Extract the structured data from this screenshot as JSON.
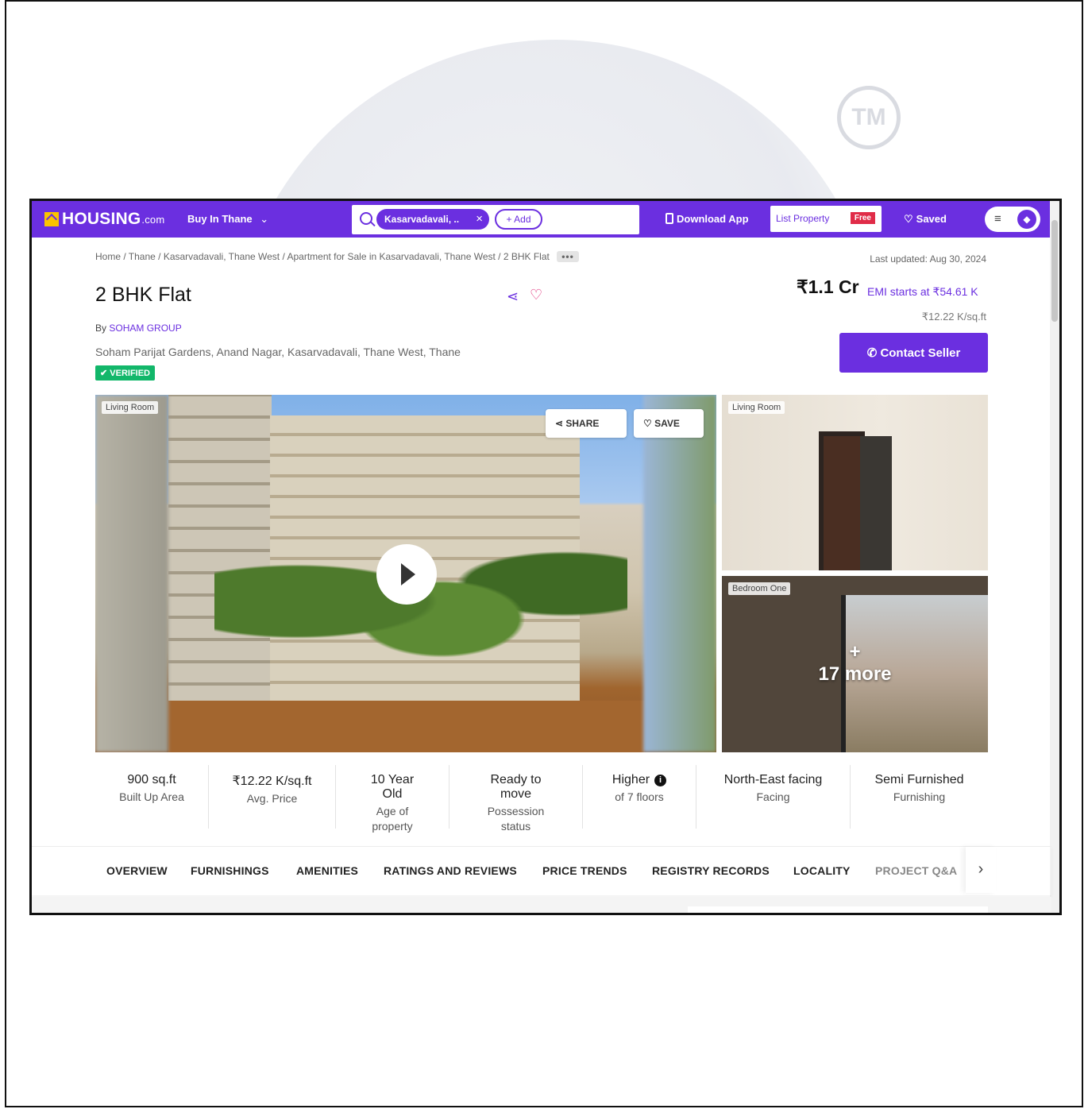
{
  "navbar": {
    "logo_text": "HOUSING",
    "logo_suffix": ".com",
    "city_menu": "Buy In Thane",
    "search_chip": "Kasarvadavali, ..",
    "add_chip": "+ Add",
    "download_app": "Download App",
    "list_property": "List Property",
    "free_badge": "Free",
    "saved": "Saved",
    "menu_icon": "hamburger-icon",
    "brand_color": "#6b2fe0"
  },
  "breadcrumb": {
    "trail": "Home / Thane / Kasarvadavali, Thane West / Apartment for Sale in Kasarvadavali, Thane West / 2 BHK Flat",
    "more": "•••"
  },
  "last_updated": "Last updated: Aug 30, 2024",
  "listing": {
    "title": "2 BHK Flat",
    "by_prefix": "By",
    "developer": "SOHAM GROUP",
    "address": "Soham Parijat Gardens, Anand Nagar, Kasarvadavali, Thane West, Thane",
    "verified": "✔ VERIFIED",
    "price": "₹1.1 Cr",
    "emi": "EMI starts at ₹54.61 K",
    "price_per_sqft": "₹12.22 K/sq.ft",
    "contact_button": "Contact Seller"
  },
  "gallery": {
    "main_tag": "Living Room",
    "share_label": "SHARE",
    "save_label": "SAVE",
    "side1_tag": "Living Room",
    "side2_tag": "Bedroom One",
    "more_plus": "+",
    "more_label": "17 more"
  },
  "facts": [
    {
      "value": "900 sq.ft",
      "label": "Built Up Area"
    },
    {
      "value": "₹12.22 K/sq.ft",
      "label": "Avg. Price"
    },
    {
      "value": "10 Year Old",
      "label": "Age of property"
    },
    {
      "value": "Ready to move",
      "label": "Possession status"
    },
    {
      "value": "Higher",
      "label": "of 7 floors"
    },
    {
      "value": "North-East facing",
      "label": "Facing"
    },
    {
      "value": "Semi Furnished",
      "label": "Furnishing"
    }
  ],
  "tabs": [
    "OVERVIEW",
    "FURNISHINGS",
    "AMENITIES",
    "RATINGS AND REVIEWS",
    "PRICE TRENDS",
    "REGISTRY RECORDS",
    "LOCALITY",
    "PROJECT Q&A"
  ],
  "watermark": {
    "tm": "TM"
  }
}
